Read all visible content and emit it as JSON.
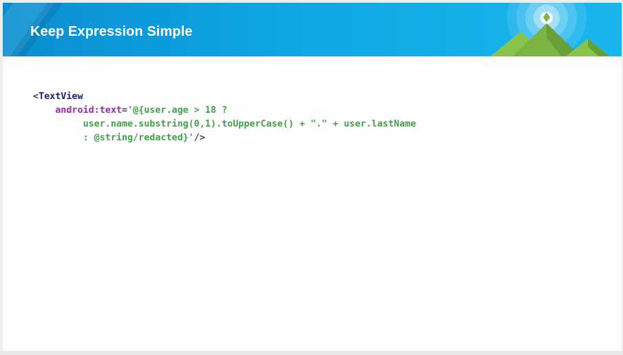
{
  "slide": {
    "title": "Keep Expression Simple"
  },
  "code": {
    "line1": {
      "open": "<",
      "tag": "TextView"
    },
    "line2": {
      "indent": "    ",
      "attr": "android:text",
      "eq": "=",
      "value": "'@{user.age > 18 ?"
    },
    "line3": {
      "indent": "         ",
      "value": "user.name.substring(0,1).toUpperCase() + \".\" + user.lastName"
    },
    "line4": {
      "indent": "         ",
      "value": ": @string/redacted}'",
      "close": "/>"
    }
  },
  "colors": {
    "header_blue": "#0ea6e3",
    "tag_navy": "#1a237e",
    "attr_purple": "#9c27b0",
    "string_green": "#43a047"
  },
  "icons": {
    "header_art": "android-mountain-logo"
  }
}
